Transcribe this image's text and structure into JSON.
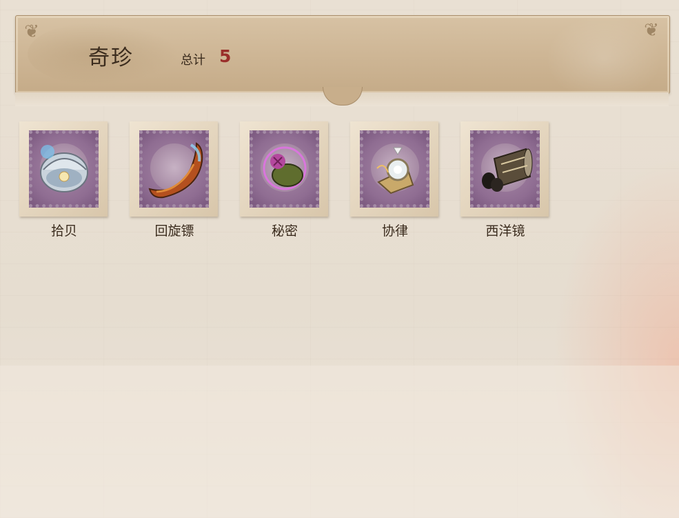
{
  "header": {
    "title": "奇珍",
    "total_label": "总计",
    "total_value": "5"
  },
  "items": [
    {
      "label": "拾贝",
      "icon": "pearl-shell-icon"
    },
    {
      "label": "回旋镖",
      "icon": "boomerang-icon"
    },
    {
      "label": "秘密",
      "icon": "secret-flower-icon"
    },
    {
      "label": "协律",
      "icon": "music-box-icon"
    },
    {
      "label": "西洋镜",
      "icon": "kaleidoscope-icon"
    }
  ],
  "colors": {
    "title_text": "#3b2c1e",
    "total_value": "#9a2e2a",
    "stamp_purple": "#8f6d92",
    "header_bg": "#cdb594"
  }
}
